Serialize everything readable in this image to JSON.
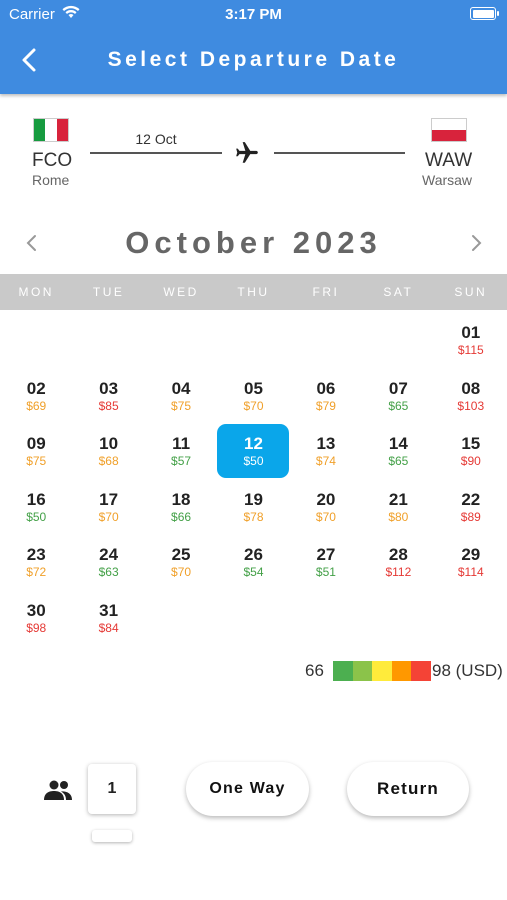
{
  "status_bar": {
    "carrier": "Carrier",
    "time": "3:17 PM"
  },
  "header": {
    "title": "Select Departure Date",
    "back_icon": "chevron-left-icon"
  },
  "route": {
    "origin": {
      "code": "FCO",
      "city": "Rome",
      "flag": "italy-flag"
    },
    "destination": {
      "code": "WAW",
      "city": "Warsaw",
      "flag": "poland-flag"
    },
    "date": "12 Oct",
    "plane_icon": "airplane-icon"
  },
  "calendar": {
    "month_title": "October 2023",
    "weekdays": [
      "MON",
      "TUE",
      "WED",
      "THU",
      "FRI",
      "SAT",
      "SUN"
    ],
    "selected_day": "12",
    "days": [
      {
        "num": "01",
        "price": "$115",
        "level": "red"
      },
      {
        "num": "02",
        "price": "$69",
        "level": "orange"
      },
      {
        "num": "03",
        "price": "$85",
        "level": "red"
      },
      {
        "num": "04",
        "price": "$75",
        "level": "orange"
      },
      {
        "num": "05",
        "price": "$70",
        "level": "orange"
      },
      {
        "num": "06",
        "price": "$79",
        "level": "orange"
      },
      {
        "num": "07",
        "price": "$65",
        "level": "green"
      },
      {
        "num": "08",
        "price": "$103",
        "level": "red"
      },
      {
        "num": "09",
        "price": "$75",
        "level": "orange"
      },
      {
        "num": "10",
        "price": "$68",
        "level": "orange"
      },
      {
        "num": "11",
        "price": "$57",
        "level": "green"
      },
      {
        "num": "12",
        "price": "$50",
        "level": "green"
      },
      {
        "num": "13",
        "price": "$74",
        "level": "orange"
      },
      {
        "num": "14",
        "price": "$65",
        "level": "green"
      },
      {
        "num": "15",
        "price": "$90",
        "level": "red"
      },
      {
        "num": "16",
        "price": "$50",
        "level": "green"
      },
      {
        "num": "17",
        "price": "$70",
        "level": "orange"
      },
      {
        "num": "18",
        "price": "$66",
        "level": "green"
      },
      {
        "num": "19",
        "price": "$78",
        "level": "orange"
      },
      {
        "num": "20",
        "price": "$70",
        "level": "orange"
      },
      {
        "num": "21",
        "price": "$80",
        "level": "orange"
      },
      {
        "num": "22",
        "price": "$89",
        "level": "red"
      },
      {
        "num": "23",
        "price": "$72",
        "level": "orange"
      },
      {
        "num": "24",
        "price": "$63",
        "level": "green"
      },
      {
        "num": "25",
        "price": "$70",
        "level": "orange"
      },
      {
        "num": "26",
        "price": "$54",
        "level": "green"
      },
      {
        "num": "27",
        "price": "$51",
        "level": "green"
      },
      {
        "num": "28",
        "price": "$112",
        "level": "red"
      },
      {
        "num": "29",
        "price": "$114",
        "level": "red"
      },
      {
        "num": "30",
        "price": "$98",
        "level": "red"
      },
      {
        "num": "31",
        "price": "$84",
        "level": "red"
      }
    ]
  },
  "legend": {
    "min": "66",
    "max": "98 (USD)",
    "colors": [
      "#4caf50",
      "#8bc34a",
      "#ffeb3b",
      "#ff9800",
      "#f44336"
    ]
  },
  "colors": {
    "header": "#3f8be0",
    "selected": "#0aa6ea",
    "price_green": "#43a047",
    "price_orange": "#f0a02a",
    "price_red": "#e53935"
  },
  "footer": {
    "passenger_icon": "people-icon",
    "passengers": "1",
    "one_way_label": "One Way",
    "return_label": "Return"
  }
}
